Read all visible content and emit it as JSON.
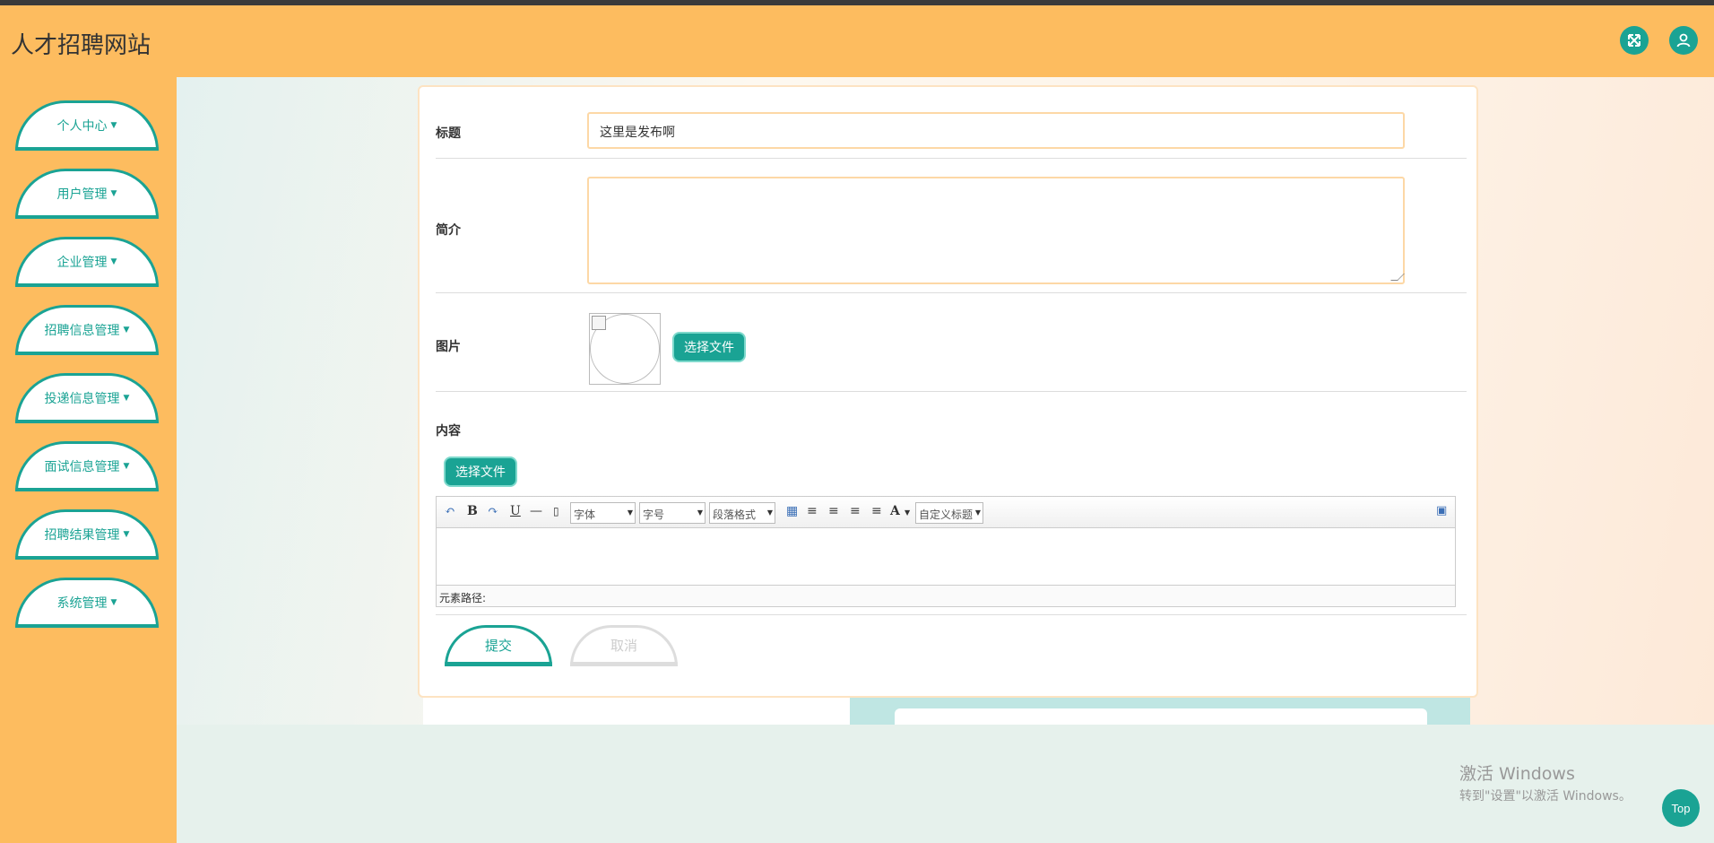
{
  "header": {
    "site_title": "人才招聘网站",
    "fullscreen_icon": "expand-icon",
    "user_icon": "user-icon"
  },
  "sidebar": {
    "items": [
      {
        "label": "个人中心"
      },
      {
        "label": "用户管理"
      },
      {
        "label": "企业管理"
      },
      {
        "label": "招聘信息管理"
      },
      {
        "label": "投递信息管理"
      },
      {
        "label": "面试信息管理"
      },
      {
        "label": "招聘结果管理"
      },
      {
        "label": "系统管理"
      }
    ]
  },
  "form": {
    "title_label": "标题",
    "title_value": "这里是发布啊",
    "intro_label": "简介",
    "intro_value": "",
    "image_label": "图片",
    "image_button": "选择文件",
    "content_label": "内容",
    "content_button": "选择文件",
    "submit_label": "提交",
    "cancel_label": "取消"
  },
  "editor": {
    "font_select": "字体",
    "size_select": "字号",
    "paragraph_select": "段落格式",
    "custom_title_select": "自定义标题",
    "bold": "B",
    "underline": "U",
    "hr": "—",
    "font_color": "A",
    "path_label": "元素路径:"
  },
  "overlay": {
    "windows_line1": "激活 Windows",
    "windows_line2": "转到\"设置\"以激活 Windows。",
    "top_button": "Top"
  },
  "colors": {
    "accent": "#1aa394",
    "header_bg": "#fdbc5f",
    "input_border": "#fdd8a6"
  }
}
